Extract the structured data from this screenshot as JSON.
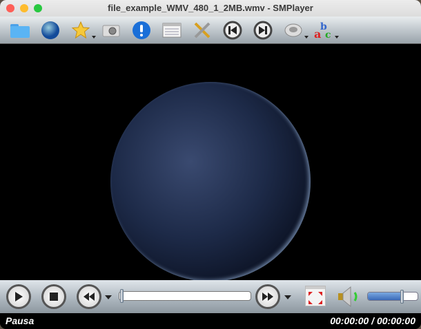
{
  "window": {
    "title": "file_example_WMV_480_1_2MB.wmv - SMPlayer"
  },
  "toolbar": {
    "items": [
      "folder-icon",
      "globe-icon",
      "star-icon",
      "camera-icon",
      "info-icon",
      "playlist-icon",
      "tools-icon",
      "previous-icon",
      "next-icon",
      "audio-icon",
      "subtitles-icon"
    ]
  },
  "controls": {
    "seek_position": 0,
    "volume": 0.7
  },
  "status": {
    "state": "Pausa",
    "time": "00:00:00 / 00:00:00"
  },
  "colors": {
    "close": "#fe5f57",
    "minimize": "#febc2e",
    "maximize": "#28c840",
    "volume_fill": "#4a7fc8"
  }
}
